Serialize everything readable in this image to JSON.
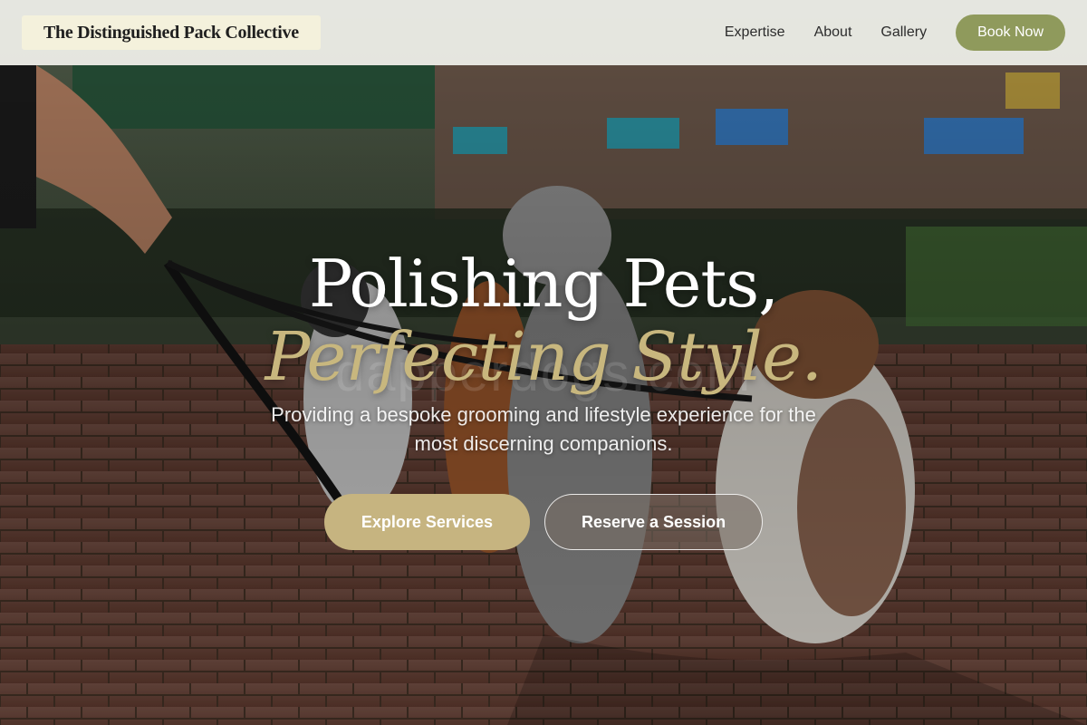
{
  "header": {
    "logo": "The Distinguished Pack Collective",
    "nav": [
      "Expertise",
      "About",
      "Gallery"
    ],
    "cta": "Book Now"
  },
  "hero": {
    "headline_line1": "Polishing Pets,",
    "headline_line2": "Perfecting Style.",
    "watermark": "dapperdogs.com",
    "subtitle": "Providing a bespoke grooming and lifestyle experience for the most discerning companions.",
    "primary_button": "Explore Services",
    "secondary_button": "Reserve a Session",
    "image": "four dogs on leashes sitting on a brick plaza in a city park"
  },
  "colors": {
    "accent_olive": "#8f9a5c",
    "accent_gold": "#c6b480",
    "header_bg": "#f1f1ec",
    "logo_bg": "#f4f1dc"
  }
}
